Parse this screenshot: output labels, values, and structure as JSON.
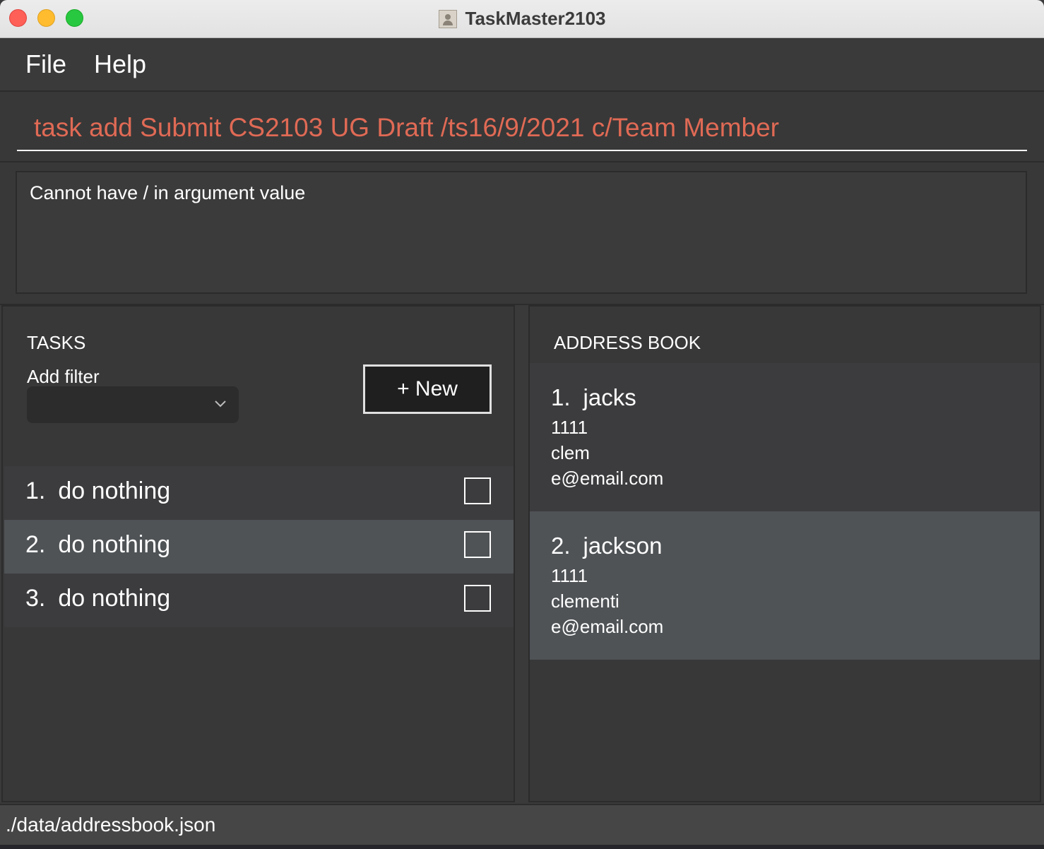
{
  "window": {
    "title": "TaskMaster2103"
  },
  "menu": {
    "items": [
      "File",
      "Help"
    ]
  },
  "command": {
    "value": "task add Submit CS2103 UG Draft /ts16/9/2021 c/Team Member"
  },
  "result": {
    "message": "Cannot have / in argument value"
  },
  "tasks_panel": {
    "heading": "TASKS",
    "filter_label": "Add filter",
    "filter_selected": "",
    "new_button_label": "+ New",
    "tasks": [
      {
        "index": "1.",
        "name": "do nothing",
        "done": false
      },
      {
        "index": "2.",
        "name": "do nothing",
        "done": false
      },
      {
        "index": "3.",
        "name": "do nothing",
        "done": false
      }
    ]
  },
  "address_panel": {
    "heading": "ADDRESS BOOK",
    "contacts": [
      {
        "index": "1.",
        "name": "jacks",
        "phone": "1111",
        "address": "clem",
        "email": "e@email.com"
      },
      {
        "index": "2.",
        "name": "jackson",
        "phone": "1111",
        "address": "clementi",
        "email": "e@email.com"
      }
    ]
  },
  "status": {
    "path": "./data/addressbook.json"
  },
  "colors": {
    "background": "#383838",
    "command_text": "#e06a55",
    "row_light": "#4f5356",
    "row_dark": "#3c3c3e",
    "close": "#fe5f57",
    "minimize": "#febc2e",
    "maximize": "#28c840"
  },
  "icons": {
    "app": "address-book-icon",
    "filter_dropdown": "chevron-down-icon",
    "checkbox": "checkbox-empty-icon"
  }
}
